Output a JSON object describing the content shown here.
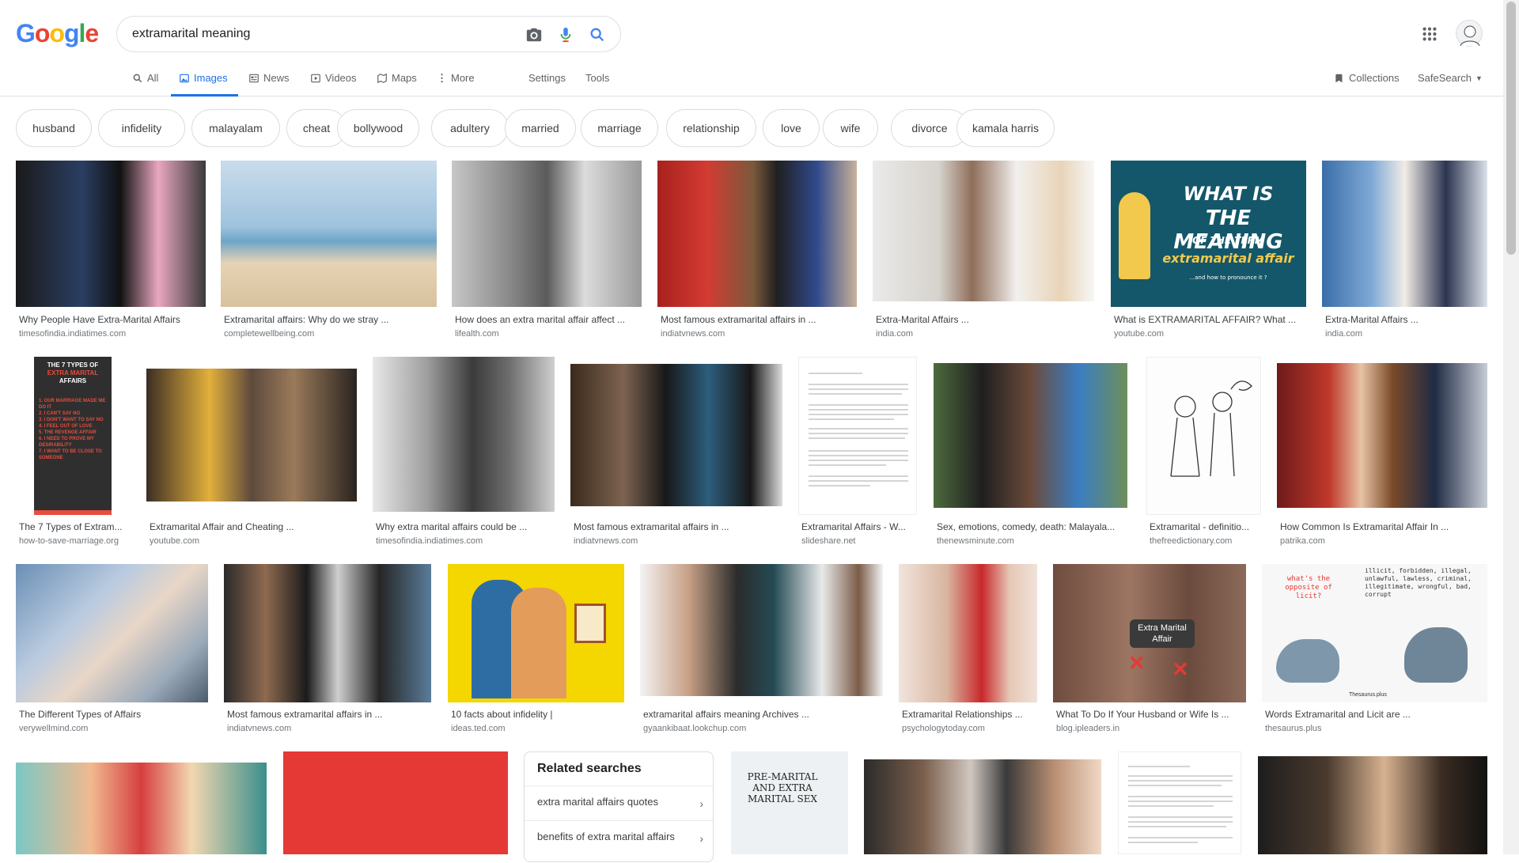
{
  "search": {
    "query": "extramarital meaning"
  },
  "logo": {
    "letters": [
      "G",
      "o",
      "o",
      "g",
      "l",
      "e"
    ],
    "colors": [
      "#4285f4",
      "#ea4335",
      "#fbbc05",
      "#4285f4",
      "#34a853",
      "#ea4335"
    ]
  },
  "tabs": [
    {
      "label": "All",
      "icon": "search-icon"
    },
    {
      "label": "Images",
      "icon": "image-icon",
      "active": true
    },
    {
      "label": "News",
      "icon": "news-icon"
    },
    {
      "label": "Videos",
      "icon": "video-icon"
    },
    {
      "label": "Maps",
      "icon": "map-icon"
    },
    {
      "label": "More",
      "icon": "more-vertical-icon"
    },
    {
      "label": "Settings"
    },
    {
      "label": "Tools"
    }
  ],
  "header_right": {
    "collections": "Collections",
    "safesearch": "SafeSearch"
  },
  "chips": [
    "husband",
    "infidelity",
    "malayalam",
    "cheat",
    "bollywood",
    "adultery",
    "married",
    "marriage",
    "relationship",
    "love",
    "wife",
    "divorce",
    "kamala harris"
  ],
  "results": [
    {
      "title": "Why People Have Extra-Marital Affairs",
      "source": "timesofindia.indiatimes.com"
    },
    {
      "title": "Extramarital affairs: Why do we stray ...",
      "source": "completewellbeing.com"
    },
    {
      "title": "How does an extra marital affair affect ...",
      "source": "lifealth.com"
    },
    {
      "title": "Most famous extramarital affairs in ...",
      "source": "indiatvnews.com"
    },
    {
      "title": "Extra-Marital Affairs ...",
      "source": "india.com"
    },
    {
      "title": "What is EXTRAMARITAL AFFAIR? What ...",
      "source": "youtube.com"
    },
    {
      "title": "Extra-Marital Affairs ...",
      "source": "india.com"
    },
    {
      "title": "The 7 Types of Extram...",
      "source": "how-to-save-marriage.org"
    },
    {
      "title": "Extramarital Affair and Cheating ...",
      "source": "youtube.com"
    },
    {
      "title": "Why extra marital affairs could be ...",
      "source": "timesofindia.indiatimes.com"
    },
    {
      "title": "Most famous extramarital affairs in ...",
      "source": "indiatvnews.com"
    },
    {
      "title": "Extramarital Affairs - W...",
      "source": "slideshare.net"
    },
    {
      "title": "Sex, emotions, comedy, death: Malayala...",
      "source": "thenewsminute.com"
    },
    {
      "title": "Extramarital - definitio...",
      "source": "thefreedictionary.com"
    },
    {
      "title": "How Common Is Extramarital Affair In ...",
      "source": "patrika.com"
    },
    {
      "title": "The Different Types of Affairs",
      "source": "verywellmind.com"
    },
    {
      "title": "Most famous extramarital affairs in ...",
      "source": "indiatvnews.com"
    },
    {
      "title": "10 facts about infidelity |",
      "source": "ideas.ted.com"
    },
    {
      "title": "extramarital affairs meaning Archives ...",
      "source": "gyaankibaat.lookchup.com"
    },
    {
      "title": "Extramarital Relationships ...",
      "source": "psychologytoday.com"
    },
    {
      "title": "What To Do If Your Husband or Wife Is ...",
      "source": "blog.ipleaders.in"
    },
    {
      "title": "Words Extramarital and Licit are ...",
      "source": "thesaurus.plus"
    }
  ],
  "image_text": {
    "youtube_line1": "WHAT IS",
    "youtube_line2": "THE MEANING",
    "youtube_line3": "OF THE TERM",
    "youtube_line4": "extramarital affair",
    "youtube_line5": "...and how to pronounce it ?",
    "types_line1": "THE 7 TYPES OF",
    "types_line2": "EXTRA MARITAL",
    "types_line3": "AFFAIRS",
    "types_items": [
      "1. OUR MARRIAGE MADE ME DO IT",
      "2. I CAN'T SAY NO",
      "3. I DON'T WANT TO SAY NO",
      "4. I FEEL OUT OF LOVE",
      "5. THE REVENGE AFFAIR",
      "6. I NEED TO PROVE MY DESIRABILITY",
      "7. I WANT TO BE CLOSE TO SOMEONE"
    ],
    "hand_label": "Extra Marital Affair",
    "pigeon_left": "what's the opposite of licit?",
    "pigeon_right": "illicit, forbidden, illegal, unlawful, lawless, criminal, illegitimate, wrongful, bad, corrupt",
    "pigeon_brand": "Thesaurus.plus",
    "premarital": "PRE-MARITAL AND EXTRA MARITAL SEX"
  },
  "related": {
    "heading": "Related searches",
    "items": [
      "extra marital affairs quotes",
      "benefits of extra marital affairs"
    ]
  }
}
